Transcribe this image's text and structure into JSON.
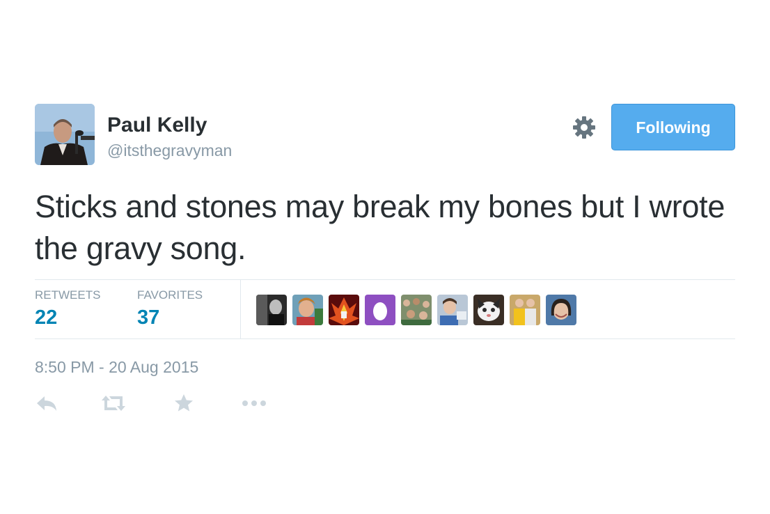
{
  "user": {
    "name": "Paul Kelly",
    "handle": "@itsthegravyman"
  },
  "follow_button": {
    "label": "Following"
  },
  "tweet": {
    "text": "Sticks and stones may break my bones but I wrote the gravy song."
  },
  "stats": {
    "retweets_label": "RETWEETS",
    "retweets_count": "22",
    "favorites_label": "FAVORITES",
    "favorites_count": "37"
  },
  "favoriters": [
    {
      "icon": "avatar-dark-photo"
    },
    {
      "icon": "avatar-person-photo"
    },
    {
      "icon": "avatar-fire-art"
    },
    {
      "icon": "avatar-default-egg"
    },
    {
      "icon": "avatar-crowd-photo"
    },
    {
      "icon": "avatar-person-computer"
    },
    {
      "icon": "avatar-cat-photo"
    },
    {
      "icon": "avatar-two-people"
    },
    {
      "icon": "avatar-woman-photo"
    }
  ],
  "timestamp": "8:50 PM - 20 Aug 2015",
  "colors": {
    "accent": "#55acee",
    "link": "#0084b4",
    "muted": "#8899a6",
    "text": "#292f33",
    "action_icon": "#ccd6dd"
  },
  "actions": [
    "reply-icon",
    "retweet-icon",
    "favorite-icon",
    "more-icon"
  ]
}
